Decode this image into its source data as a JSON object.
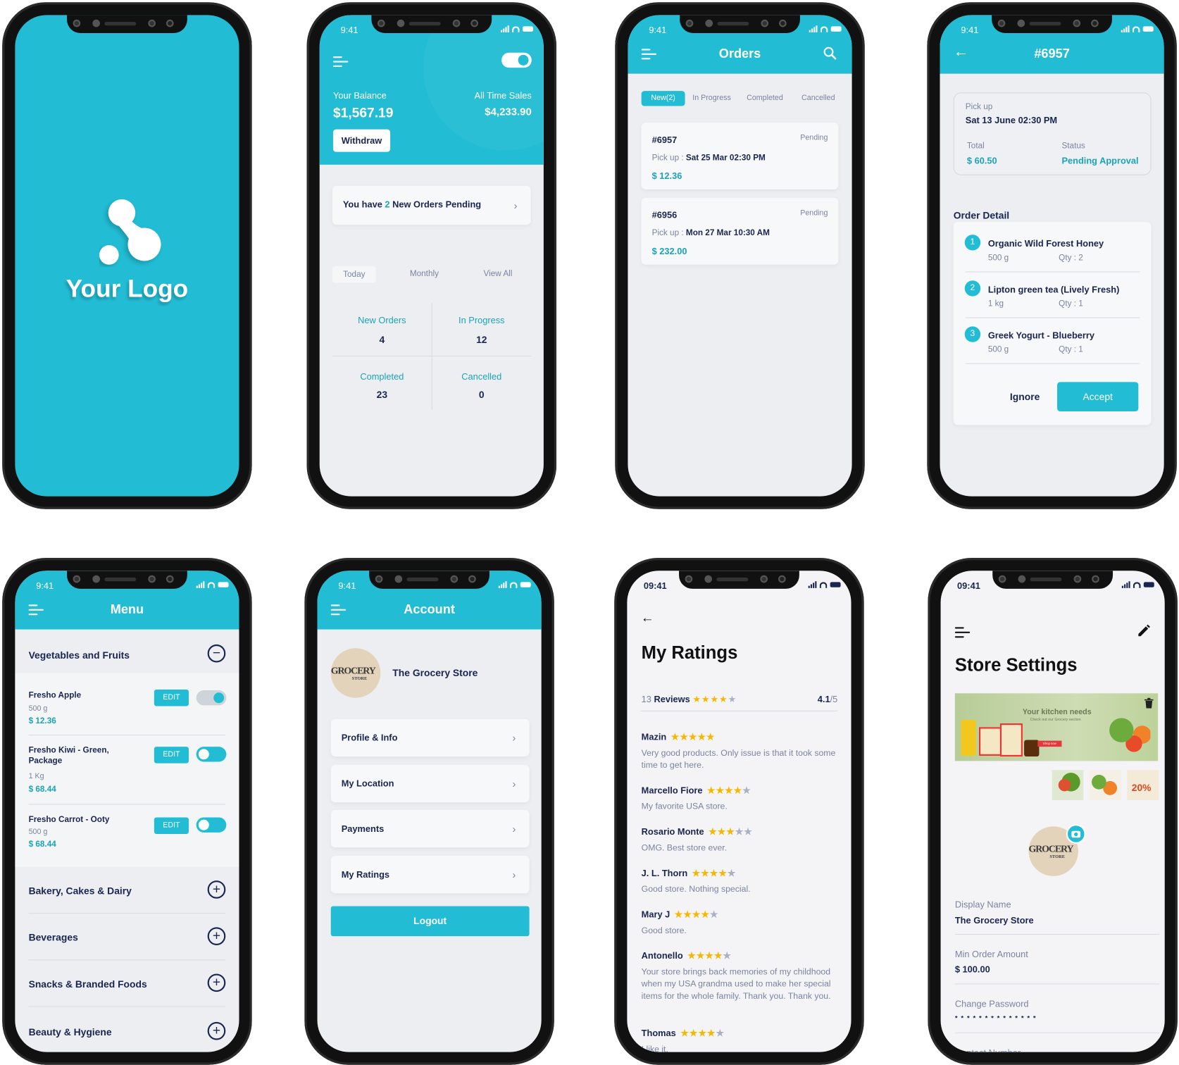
{
  "colors": {
    "brand": "#22bdd4",
    "navy": "#1a2550",
    "star": "#f5b800"
  },
  "status_time": "9:41",
  "status_time_alt": "09:41",
  "splash": {
    "logo_text": "Your Logo"
  },
  "dashboard": {
    "balance_label": "Your Balance",
    "balance": "$1,567.19",
    "sales_label": "All Time Sales",
    "sales": "$4,233.90",
    "withdraw": "Withdraw",
    "pending_prefix": "You have",
    "pending_count": "2",
    "pending_suffix": "New Orders Pending",
    "tabs": [
      "Today",
      "Monthly",
      "View All"
    ],
    "stats": [
      {
        "label": "New Orders",
        "value": "4"
      },
      {
        "label": "In Progress",
        "value": "12"
      },
      {
        "label": "Completed",
        "value": "23"
      },
      {
        "label": "Cancelled",
        "value": "0"
      }
    ]
  },
  "orders": {
    "title": "Orders",
    "tabs": [
      "New(2)",
      "In Progress",
      "Completed",
      "Cancelled"
    ],
    "list": [
      {
        "id": "#6957",
        "status": "Pending",
        "pickup_label": "Pick up :",
        "pickup": "Sat 25 Mar 02:30 PM",
        "amount": "$ 12.36"
      },
      {
        "id": "#6956",
        "status": "Pending",
        "pickup_label": "Pick up :",
        "pickup": "Mon 27 Mar 10:30 AM",
        "amount": "$ 232.00"
      }
    ]
  },
  "order_detail": {
    "title": "#6957",
    "pickup_label": "Pick up",
    "pickup": "Sat 13 June 02:30 PM",
    "total_label": "Total",
    "total": "$ 60.50",
    "status_label": "Status",
    "status": "Pending Approval",
    "section": "Order Detail",
    "items": [
      {
        "n": "1",
        "name": "Organic Wild Forest Honey",
        "size": "500 g",
        "qty": "Qty : 2"
      },
      {
        "n": "2",
        "name": "Lipton green tea (Lively Fresh)",
        "size": "1 kg",
        "qty": "Qty : 1"
      },
      {
        "n": "3",
        "name": "Greek Yogurt - Blueberry",
        "size": "500 g",
        "qty": "Qty : 1"
      }
    ],
    "ignore": "Ignore",
    "accept": "Accept"
  },
  "menu": {
    "title": "Menu",
    "open_category": "Vegetables and Fruits",
    "items": [
      {
        "name": "Fresho Apple",
        "size": "500 g",
        "price": "$ 12.36",
        "edit": "EDIT",
        "on": true
      },
      {
        "name": "Fresho Kiwi - Green, Package",
        "size": "1 Kg",
        "price": "$ 68.44",
        "edit": "EDIT",
        "on": false
      },
      {
        "name": "Fresho Carrot - Ooty",
        "size": "500 g",
        "price": "$ 68.44",
        "edit": "EDIT",
        "on": false
      }
    ],
    "categories": [
      "Bakery, Cakes & Dairy",
      "Beverages",
      "Snacks & Branded Foods",
      "Beauty & Hygiene"
    ]
  },
  "account": {
    "title": "Account",
    "store_name": "The Grocery Store",
    "logo_text": "GROCERY",
    "logo_sub": "STORE",
    "items": [
      "Profile & Info",
      "My Location",
      "Payments",
      "My Ratings"
    ],
    "logout": "Logout"
  },
  "ratings": {
    "title": "My Ratings",
    "count": "13",
    "count_label": "Reviews",
    "average": "4.1",
    "average_suffix": "/5",
    "average_stars": 4,
    "reviews": [
      {
        "name": "Mazin",
        "stars": 5,
        "text": "Very good products. Only issue is that it took some time to get here."
      },
      {
        "name": "Marcello Fiore",
        "stars": 4,
        "text": "My favorite USA store."
      },
      {
        "name": "Rosario Monte",
        "stars": 3,
        "text": "OMG. Best store ever."
      },
      {
        "name": "J. L. Thorn",
        "stars": 4,
        "text": "Good store. Nothing special."
      },
      {
        "name": "Mary J",
        "stars": 4,
        "text": "Good store."
      },
      {
        "name": "Antonello",
        "stars": 4,
        "text": "Your store brings back memories of my childhood when my USA grandma used to make her special items for the whole family. Thank you. Thank you."
      },
      {
        "name": "Thomas",
        "stars": 4,
        "text": "I like it."
      }
    ]
  },
  "store_settings": {
    "title": "Store Settings",
    "banner_title": "Your kitchen needs",
    "banner_sub": "Check out our Grocery section",
    "banner_btn": "Shop now",
    "thumb_badge": "20%",
    "fields": [
      {
        "label": "Display Name",
        "value": "The Grocery Store"
      },
      {
        "label": "Min Order Amount",
        "value": "$ 100.00"
      },
      {
        "label": "Change Password",
        "value": "* * * * * * * * * * * * * *"
      },
      {
        "label": "Contact Number",
        "value": ""
      }
    ]
  }
}
